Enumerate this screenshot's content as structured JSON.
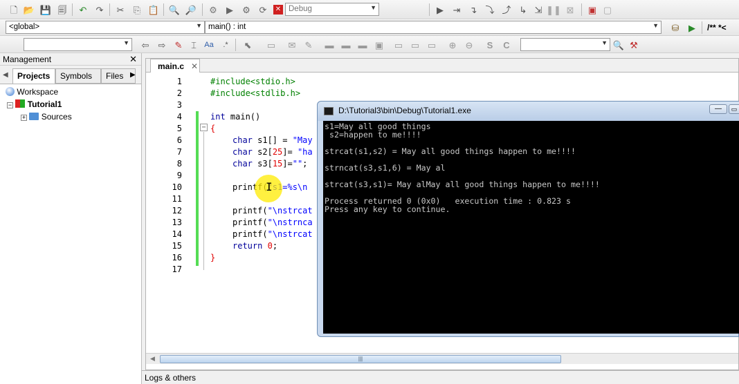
{
  "toolbar": {
    "build_target": "Debug",
    "scope": "<global>",
    "function": "main() : int",
    "comment_label": "/** *<"
  },
  "management": {
    "title": "Management",
    "tabs": [
      "Projects",
      "Symbols",
      "Files"
    ],
    "tree": {
      "workspace": "Workspace",
      "project": "Tutorial1",
      "folder": "Sources"
    }
  },
  "editor": {
    "tab": "main.c",
    "lines": [
      {
        "n": "1"
      },
      {
        "n": "2"
      },
      {
        "n": "3"
      },
      {
        "n": "4"
      },
      {
        "n": "5"
      },
      {
        "n": "6"
      },
      {
        "n": "7"
      },
      {
        "n": "8"
      },
      {
        "n": "9"
      },
      {
        "n": "10"
      },
      {
        "n": "11"
      },
      {
        "n": "12"
      },
      {
        "n": "13"
      },
      {
        "n": "14"
      },
      {
        "n": "15"
      },
      {
        "n": "16"
      },
      {
        "n": "17"
      }
    ],
    "code": {
      "l1": "#include<stdio.h>",
      "l2": "#include<stdlib.h>",
      "l4a": "int",
      "l4b": " main()",
      "l5": "{",
      "l6a": "char",
      "l6b": " s1[] = ",
      "l6c": "\"May",
      "l7a": "char",
      "l7b": " s2[",
      "l7c": "25",
      "l7d": "]= ",
      "l7e": "\"ha",
      "l8a": "char",
      "l8b": " s3[",
      "l8c": "15",
      "l8d": "]=",
      "l8e": "\"\"",
      "l8f": ";",
      "l10a": "printf(",
      "l10b": "\"s1=%s\\n",
      "l12a": "printf(",
      "l12b": "\"\\nstrcat",
      "l13a": "printf(",
      "l13b": "\"\\nstrnca",
      "l14a": "printf(",
      "l14b": "\"\\nstrcat",
      "l15a": "return",
      "l15b": " 0",
      "l15c": ";",
      "l16": "}"
    },
    "bottom_panel": "Logs & others"
  },
  "console": {
    "title": "D:\\Tutorial3\\bin\\Debug\\Tutorial1.exe",
    "lines": [
      "s1=May all good things",
      " s2=happen to me!!!!",
      "",
      "strcat(s1,s2) = May all good things happen to me!!!!",
      "",
      "strncat(s3,s1,6) = May al",
      "",
      "strcat(s3,s1)= May alMay all good things happen to me!!!!",
      "",
      "Process returned 0 (0x0)   execution time : 0.823 s",
      "Press any key to continue."
    ]
  }
}
